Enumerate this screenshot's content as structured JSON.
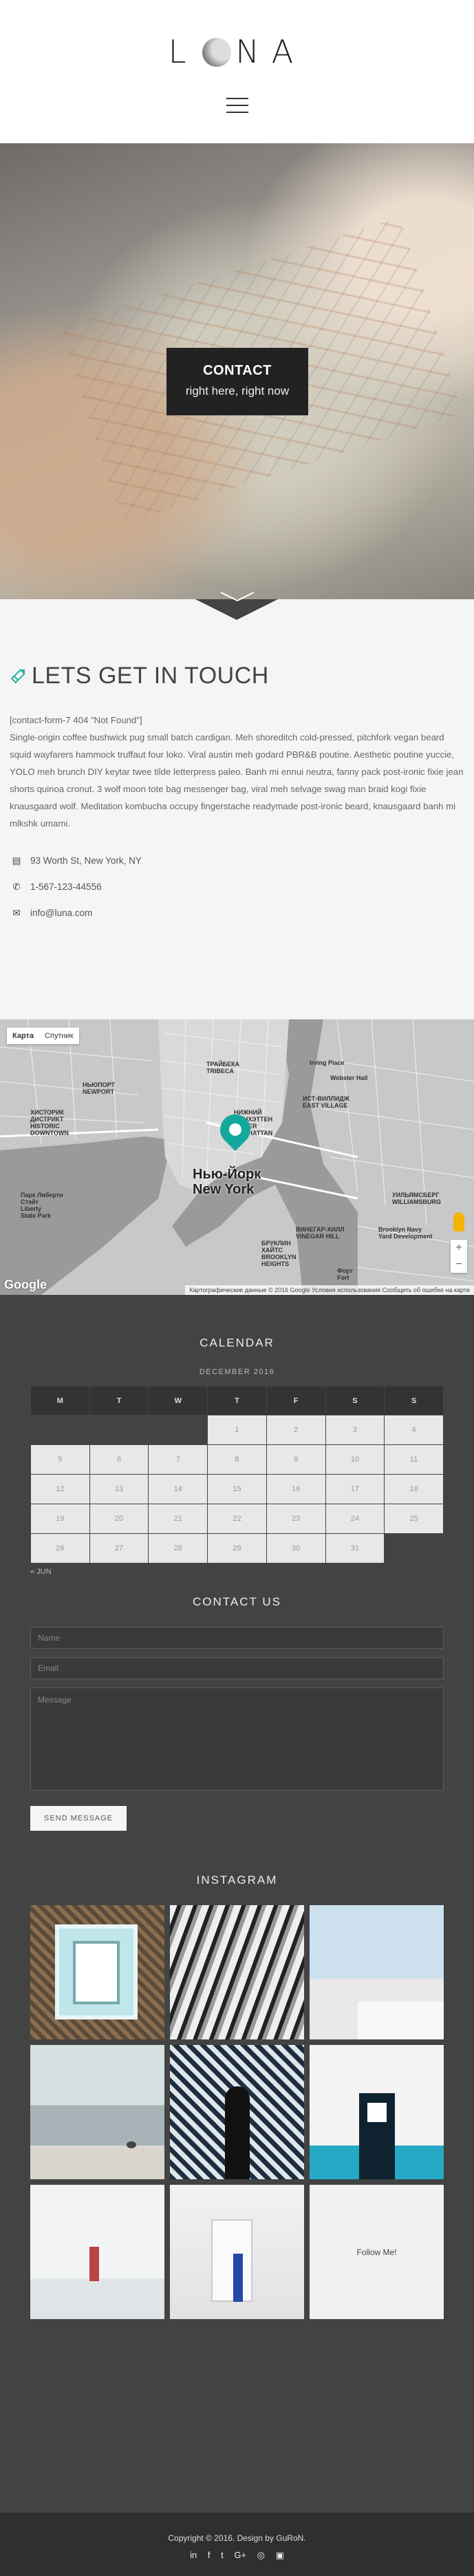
{
  "header": {
    "logo": "LUNA",
    "logo_left": "L",
    "logo_right": "NA"
  },
  "hero": {
    "title": "CONTACT",
    "subtitle": "right here, right now"
  },
  "about": {
    "heading": "LETS GET IN TOUCH",
    "error_line": "[contact-form-7 404 \"Not Found\"]",
    "body": "Single-origin coffee bushwick pug small batch cardigan. Meh shoreditch cold-pressed, pitchfork vegan beard squid wayfarers hammock truffaut four loko. Viral austin meh godard PBR&B poutine. Aesthetic poutine yuccie, YOLO meh brunch DIY keytar twee tilde letterpress paleo. Banh mi ennui neutra, fanny pack post-ironic fixie jean shorts quinoa cronut. 3 wolf moon tote bag messenger bag, viral meh selvage swag man braid kogi fixie knausgaard wolf. Meditation kombucha occupy fingerstache readymade post-ironic beard, knausgaard banh mi mlkshk umami.",
    "address": "93 Worth St, New York, NY",
    "phone": "1-567-123-44556",
    "email": "info@luna.com"
  },
  "map": {
    "toggle_map": "Карта",
    "toggle_satellite": "Спутник",
    "city_ru": "Нью-Йорк",
    "city_en": "New York",
    "attribution": "Картографические данные © 2016 Google   Условия использования   Сообщить об ошибке на карте",
    "google": "Google",
    "labels": {
      "tribeca": "ТРАЙБЕКА\nTRIBECA",
      "historic": "ХИСТОРИК\nДИСТРИКТ\nHISTORIC\nDOWNTOWN",
      "newport": "НЬЮПОРТ\nNEWPORT",
      "east_village": "ИСТ-ВИЛЛИДЖ\nEAST VILLAGE",
      "lower_manhattan": "НИЖНИЙ\nМЭНХЭТТЕН\nLOWER\nMANHATTAN",
      "williamsburg": "УИЛЬЯМСБЕРГ\nWILLIAMSBURG",
      "vinegar_hill": "ВИНЕГАР-ХИЛЛ\nVINEGAR HILL",
      "brooklyn_heights": "БРУКЛИН\nХАЙТС\nBROOKLYN\nHEIGHTS",
      "navy_yard": "Brooklyn Navy\nYard Development",
      "liberty_state": "Парк Либерти\nСтэйт\nLiberty\nState Park",
      "irving_place": "Irving Place",
      "webster_hall": "Webster Hall",
      "fort": "Форт\nFort"
    }
  },
  "calendar": {
    "heading": "CALENDAR",
    "caption": "DECEMBER 2016",
    "weekdays": [
      "M",
      "T",
      "W",
      "T",
      "F",
      "S",
      "S"
    ],
    "weeks": [
      [
        "",
        "",
        "",
        "1",
        "2",
        "3",
        "4"
      ],
      [
        "5",
        "6",
        "7",
        "8",
        "9",
        "10",
        "11"
      ],
      [
        "12",
        "13",
        "14",
        "15",
        "16",
        "17",
        "18"
      ],
      [
        "19",
        "20",
        "21",
        "22",
        "23",
        "24",
        "25"
      ],
      [
        "26",
        "27",
        "28",
        "29",
        "30",
        "31",
        ""
      ]
    ],
    "prev": "« JUN"
  },
  "contact_form": {
    "heading": "CONTACT US",
    "name_placeholder": "Name",
    "email_placeholder": "Email",
    "message_placeholder": "Message",
    "submit": "SEND MESSAGE"
  },
  "instagram": {
    "heading": "INSTAGRAM",
    "follow": "Follow Me!"
  },
  "footer": {
    "copyright": "Copyright © 2016. Design by GuRoN.",
    "social": [
      "in",
      "f",
      "t",
      "G+",
      "◎",
      "▣"
    ]
  }
}
